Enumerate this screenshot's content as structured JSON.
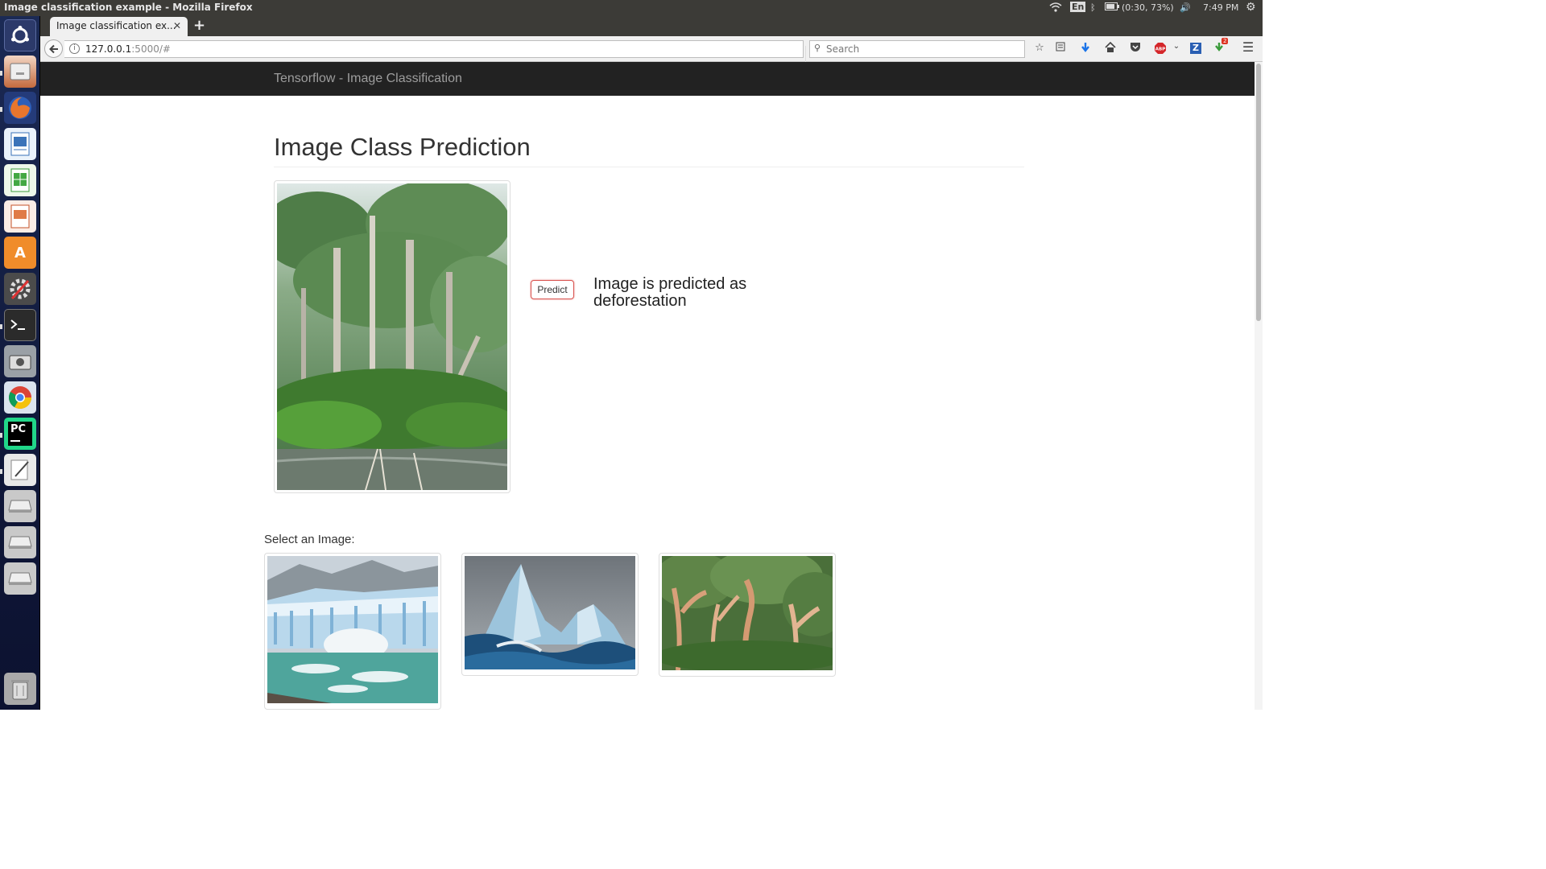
{
  "system_bar": {
    "window_title": "Image classification example - Mozilla Firefox",
    "keyboard_layout": "En",
    "battery": "(0:30, 73%)",
    "clock": "7:49 PM",
    "icons": [
      "wifi-icon",
      "bluetooth-icon",
      "battery-icon",
      "volume-icon",
      "settings-gear-icon"
    ]
  },
  "launcher": {
    "items": [
      "ubuntu-dash-icon",
      "files-icon",
      "firefox-icon",
      "writer-icon",
      "calc-icon",
      "impress-icon",
      "software-center-icon",
      "system-settings-icon",
      "terminal-icon",
      "screenshot-icon",
      "chrome-icon",
      "pycharm-icon",
      "text-editor-icon",
      "drive-icon",
      "drive-icon",
      "drive-icon",
      "trash-icon"
    ]
  },
  "browser": {
    "tab_title": "Image classification ex...",
    "url_host": "127.0.0.1",
    "url_rest": ":5000/#",
    "search_placeholder": "Search",
    "addon_badge": "2"
  },
  "app": {
    "brand": "Tensorflow - Image Classification",
    "heading": "Image Class Prediction",
    "predict_button": "Predict",
    "result_text": "Image is predicted as deforestation",
    "select_label": "Select an Image:"
  },
  "colors": {
    "navbar_bg": "#222222",
    "predict_border": "#d9534f"
  }
}
